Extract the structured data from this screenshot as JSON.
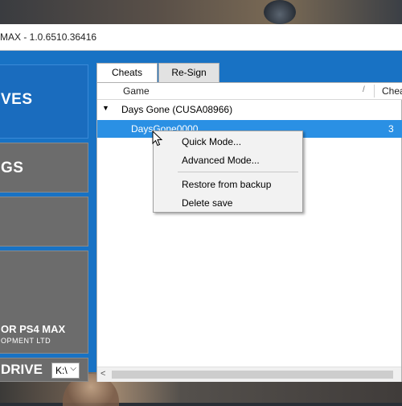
{
  "window": {
    "title": "MAX - 1.0.6510.36416"
  },
  "nav": {
    "saves_label": "VES",
    "settings_label": "GS",
    "product_label": "OR PS4 MAX",
    "company_label": "OPMENT LTD",
    "drive_label": "DRIVE",
    "drive_value": "K:\\"
  },
  "tabs": [
    {
      "label": "Cheats",
      "active": true
    },
    {
      "label": "Re-Sign",
      "active": false
    }
  ],
  "grid": {
    "headers": {
      "game": "Game",
      "cheats": "Chea"
    },
    "rows": [
      {
        "expander": "▼",
        "text": "Days Gone (CUSA08966)"
      },
      {
        "text": "DaysGone0000",
        "cheats": "3",
        "selected": true
      }
    ]
  },
  "context_menu": {
    "items": [
      "Quick Mode...",
      "Advanced Mode...",
      "Restore from backup",
      "Delete save"
    ]
  },
  "colors": {
    "accent": "#1872c4",
    "selection": "#2a90e4",
    "nav_tile": "#6c6c6c"
  }
}
